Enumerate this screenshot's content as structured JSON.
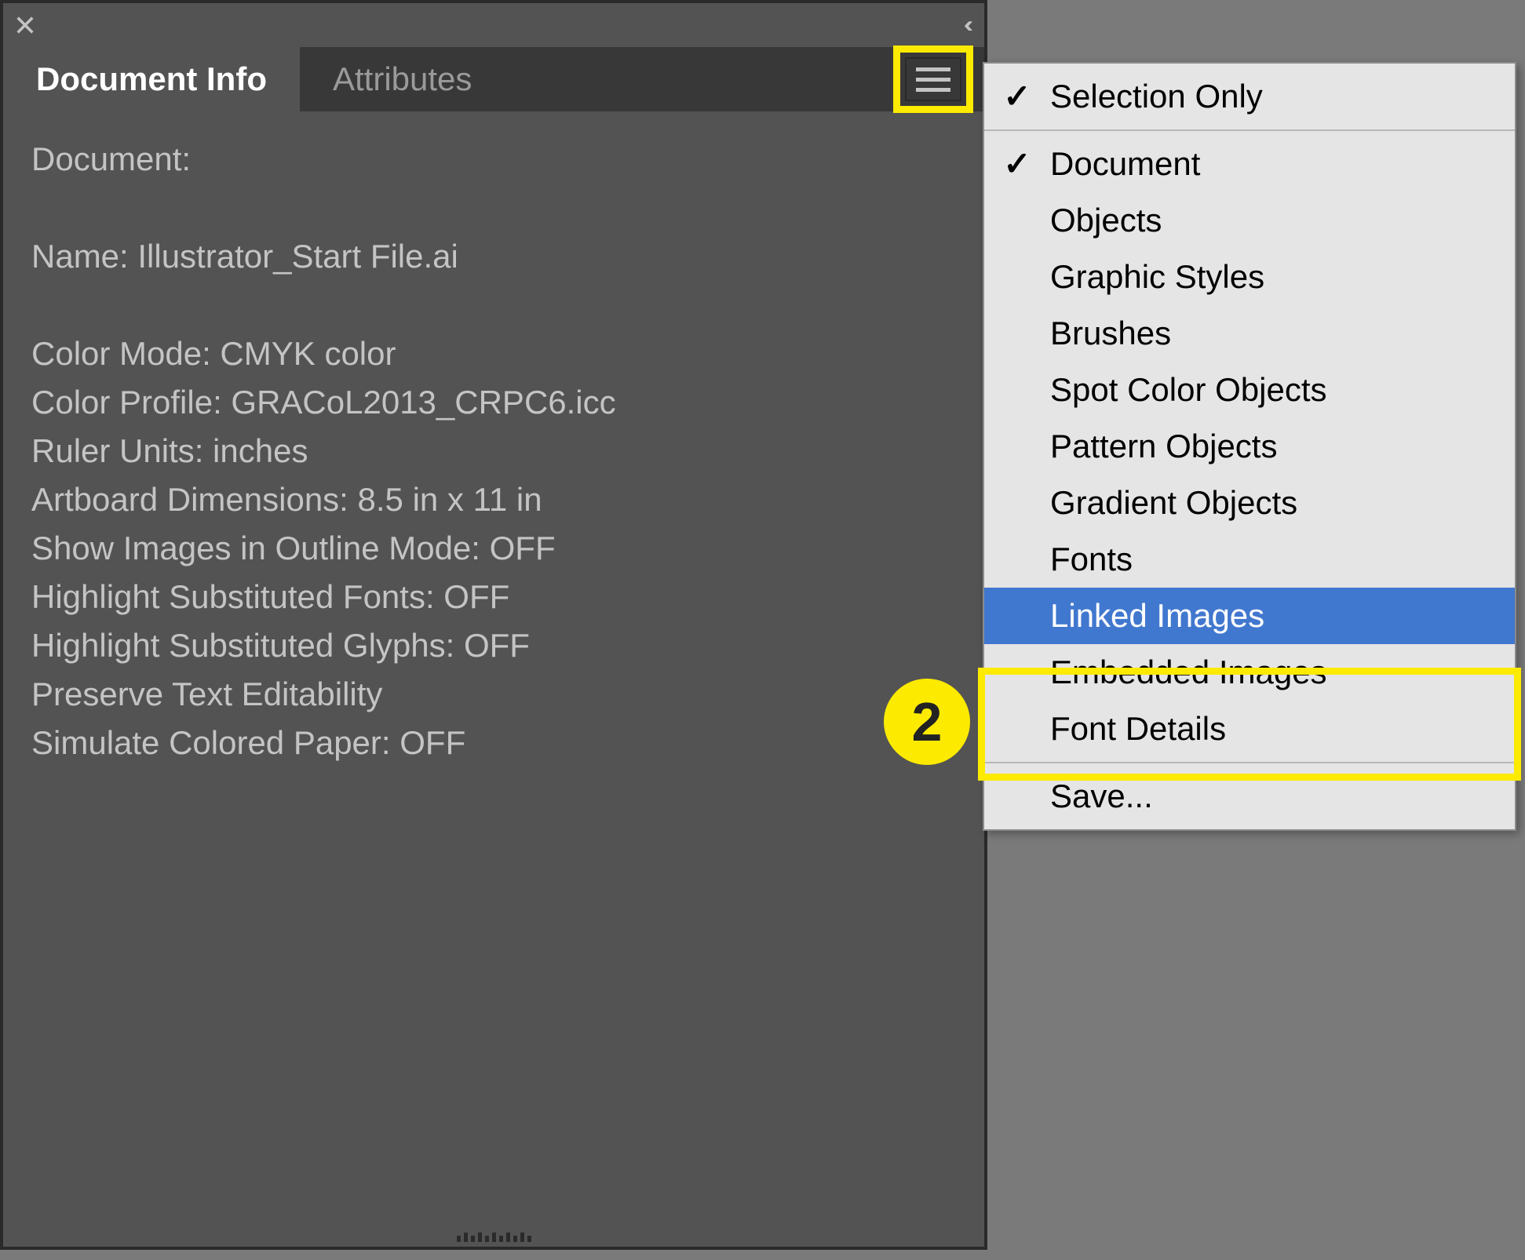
{
  "panel": {
    "tabs": {
      "document_info": "Document Info",
      "attributes": "Attributes"
    },
    "body": {
      "document_label": "Document:",
      "name_line": "Name: Illustrator_Start File.ai",
      "color_mode": "Color Mode: CMYK color",
      "color_profile": "Color Profile: GRACoL2013_CRPC6.icc",
      "ruler_units": "Ruler Units: inches",
      "artboard_dimensions": "Artboard Dimensions: 8.5 in x 11 in",
      "show_images_outline": "Show Images in Outline Mode: OFF",
      "highlight_sub_fonts": "Highlight Substituted Fonts: OFF",
      "highlight_sub_glyphs": "Highlight Substituted Glyphs: OFF",
      "preserve_text": "Preserve Text Editability",
      "simulate_paper": "Simulate Colored Paper: OFF"
    }
  },
  "flyout": {
    "selection_only": "Selection Only",
    "document": "Document",
    "objects": "Objects",
    "graphic_styles": "Graphic Styles",
    "brushes": "Brushes",
    "spot_color_objects": "Spot Color Objects",
    "pattern_objects": "Pattern Objects",
    "gradient_objects": "Gradient Objects",
    "fonts": "Fonts",
    "linked_images": "Linked Images",
    "embedded_images": "Embedded Images",
    "font_details": "Font Details",
    "save": "Save..."
  },
  "callouts": {
    "badge2": "2"
  }
}
